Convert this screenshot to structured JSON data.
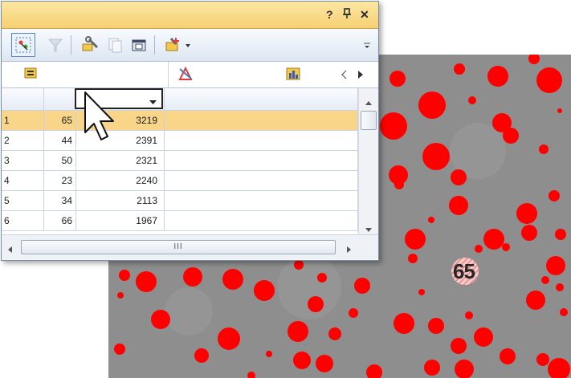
{
  "window": {
    "title_buttons": {
      "help": "?",
      "pin": "❑",
      "close": "✕"
    },
    "toolbar_icons": [
      "select-region-icon",
      "filter-icon",
      "measure-wrench-icon",
      "copy-icon",
      "export-icon",
      "add-measurement-icon",
      "overflow-chevron-icon"
    ],
    "subbar_icons": [
      "layers-icon",
      "chart-settings-icon",
      "histogram-icon",
      "scroll-left-icon",
      "scroll-right-icon"
    ]
  },
  "grid": {
    "columns": [
      "",
      "",
      ""
    ],
    "rows": [
      {
        "idx": "1",
        "a": "65",
        "b": "3219",
        "selected": true
      },
      {
        "idx": "2",
        "a": "44",
        "b": "2391",
        "selected": false
      },
      {
        "idx": "3",
        "a": "50",
        "b": "2321",
        "selected": false
      },
      {
        "idx": "4",
        "a": "23",
        "b": "2240",
        "selected": false
      },
      {
        "idx": "5",
        "a": "34",
        "b": "2113",
        "selected": false
      },
      {
        "idx": "6",
        "a": "66",
        "b": "1967",
        "selected": false
      }
    ],
    "hscroll_thumb": "III"
  },
  "image": {
    "highlight_label": "65",
    "particle_color": "#ff0000",
    "background_color": "#8e8e8e"
  },
  "colors": {
    "selection": "#f8d589",
    "titlebar": "#f7d073",
    "accent_border": "#5e83b8"
  }
}
